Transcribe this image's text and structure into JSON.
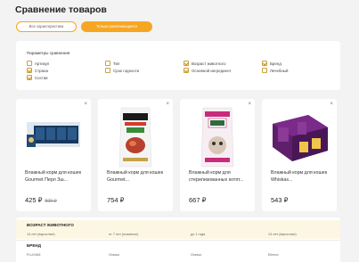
{
  "page": {
    "title": "Сравнение товаров"
  },
  "tabs": {
    "all": "Все характеристики",
    "diff": "Только различающиеся"
  },
  "params": {
    "title": "Параметры сравнения",
    "options": [
      {
        "label": "Артикул",
        "checked": false
      },
      {
        "label": "Страна",
        "checked": true
      },
      {
        "label": "Состав",
        "checked": true
      },
      {
        "label": "Тип",
        "checked": false
      },
      {
        "label": "Срок годности",
        "checked": false
      },
      {
        "label": "Возраст животного",
        "checked": true
      },
      {
        "label": "Основной ингредиент",
        "checked": true
      },
      {
        "label": "Бренд",
        "checked": true
      },
      {
        "label": "Лечебный",
        "checked": false
      }
    ]
  },
  "products": [
    {
      "name": "Влажный корм для кошек Gourmet Перл Зш...",
      "price": "425 ₽",
      "old_price": "500 ₽",
      "remove": "×"
    },
    {
      "name": "Влажный корм для кошек Gourmet...",
      "price": "754 ₽",
      "old_price": "",
      "remove": "×"
    },
    {
      "name": "Влажный корм для стерилизованных котят...",
      "price": "667 ₽",
      "old_price": "",
      "remove": "×"
    },
    {
      "name": "Влажный корм для кошек Whiskas...",
      "price": "543 ₽",
      "old_price": "",
      "remove": "×"
    }
  ],
  "table": {
    "age": {
      "label": "ВОЗРАСТ ЖИВОТНОГО",
      "values": [
        "14 лет (взрослые)",
        "от 7 лет (пожилые)",
        "до 1 года",
        "14 лет (взрослые)"
      ]
    },
    "brand": {
      "label": "БРЕНД",
      "values": [
        "FLUXAM",
        "Grasso",
        "Grasso",
        "Eleeco"
      ]
    }
  },
  "colors": {
    "accent": "#f5a623",
    "highlight": "#fdf6e3"
  }
}
